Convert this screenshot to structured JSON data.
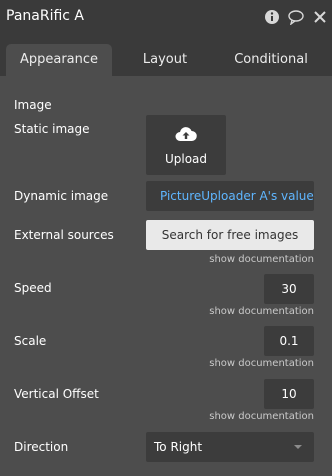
{
  "window": {
    "title": "PanaRific A"
  },
  "icons": {
    "info": "info-icon",
    "comment": "comment-icon",
    "close": "close-icon",
    "upload": "cloud-upload-icon"
  },
  "tabs": [
    {
      "label": "Appearance",
      "active": true
    },
    {
      "label": "Layout",
      "active": false
    },
    {
      "label": "Conditional",
      "active": false
    }
  ],
  "appearance": {
    "image_heading": "Image",
    "static_image_label": "Static image",
    "upload_label": "Upload",
    "dynamic_image_label": "Dynamic image",
    "dynamic_image_value": "PictureUploader A's value",
    "external_sources_label": "External sources",
    "search_button_label": "Search for free images",
    "show_doc": "show documentation",
    "speed_label": "Speed",
    "speed_value": "30",
    "scale_label": "Scale",
    "scale_value": "0.1",
    "vertical_offset_label": "Vertical Offset",
    "vertical_offset_value": "10",
    "direction_label": "Direction",
    "direction_value": "To Right"
  },
  "colors": {
    "panel_bg": "#4d4d4d",
    "header_bg": "#3a3a3a",
    "field_bg": "#3c3c3c",
    "link_blue": "#5fb6ff"
  }
}
